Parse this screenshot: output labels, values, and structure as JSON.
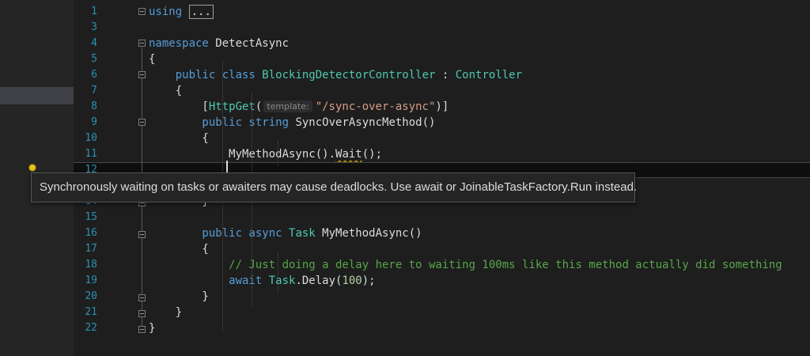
{
  "editor": {
    "lines": [
      {
        "n": "1",
        "segments": [
          {
            "t": "using",
            "c": "kw"
          },
          {
            "t": " ",
            "c": ""
          },
          {
            "t": "...",
            "c": "boxed"
          }
        ]
      },
      {
        "n": "3",
        "segments": []
      },
      {
        "n": "4",
        "segments": [
          {
            "t": "namespace",
            "c": "kw"
          },
          {
            "t": " DetectAsync",
            "c": ""
          }
        ]
      },
      {
        "n": "5",
        "segments": [
          {
            "t": "{",
            "c": ""
          }
        ]
      },
      {
        "n": "6",
        "segments": [
          {
            "t": "    public class ",
            "c": "kw"
          },
          {
            "t": "BlockingDetectorController",
            "c": "ty"
          },
          {
            "t": " : ",
            "c": ""
          },
          {
            "t": "Controller",
            "c": "ty"
          }
        ]
      },
      {
        "n": "7",
        "segments": [
          {
            "t": "    {",
            "c": ""
          }
        ]
      },
      {
        "n": "8",
        "segments": [
          {
            "t": "        [",
            "c": ""
          },
          {
            "t": "HttpGet",
            "c": "ty"
          },
          {
            "t": "(",
            "c": ""
          },
          {
            "t": "template:",
            "c": "hint"
          },
          {
            "t": "\"/sync-over-async\"",
            "c": "st"
          },
          {
            "t": ")]",
            "c": ""
          }
        ]
      },
      {
        "n": "9",
        "segments": [
          {
            "t": "        public string ",
            "c": "kw"
          },
          {
            "t": "SyncOverAsyncMethod()",
            "c": ""
          }
        ]
      },
      {
        "n": "10",
        "segments": [
          {
            "t": "        {",
            "c": ""
          }
        ]
      },
      {
        "n": "11",
        "segments": [
          {
            "t": "            MyMethodAsync().",
            "c": ""
          },
          {
            "t": "Wait",
            "c": "sq"
          },
          {
            "t": "();",
            "c": ""
          }
        ]
      },
      {
        "n": "12",
        "segments": []
      },
      {
        "n": "14",
        "segments": [
          {
            "t": "        }",
            "c": ""
          }
        ]
      },
      {
        "n": "15",
        "segments": []
      },
      {
        "n": "16",
        "segments": [
          {
            "t": "        public async ",
            "c": "kw"
          },
          {
            "t": "Task",
            "c": "ty"
          },
          {
            "t": " MyMethodAsync()",
            "c": ""
          }
        ]
      },
      {
        "n": "17",
        "segments": [
          {
            "t": "        {",
            "c": ""
          }
        ]
      },
      {
        "n": "18",
        "segments": [
          {
            "t": "            // Just doing a delay here to waiting 100ms like this method actually did something",
            "c": "cm"
          }
        ]
      },
      {
        "n": "19",
        "segments": [
          {
            "t": "            await ",
            "c": "kw"
          },
          {
            "t": "Task",
            "c": "ty"
          },
          {
            "t": ".Delay(",
            "c": ""
          },
          {
            "t": "100",
            "c": "nm"
          },
          {
            "t": ");",
            "c": ""
          }
        ]
      },
      {
        "n": "20",
        "segments": [
          {
            "t": "        }",
            "c": ""
          }
        ]
      },
      {
        "n": "21",
        "segments": [
          {
            "t": "    }",
            "c": ""
          }
        ]
      },
      {
        "n": "22",
        "segments": [
          {
            "t": "}",
            "c": ""
          }
        ]
      }
    ]
  },
  "tooltip": {
    "text": "Synchronously waiting on tasks or awaiters may cause deadlocks. Use await or JoinableTaskFactory.Run instead."
  },
  "colors": {
    "keyword": "#569cd6",
    "type": "#4ec9b0",
    "string": "#d69d85",
    "comment": "#57a64a",
    "number": "#b5cea8",
    "line_number": "#2b91af",
    "squiggle": "#c8a000"
  },
  "icons": {
    "lightbulb": "lightbulb-icon",
    "fold": "collapse-icon"
  }
}
